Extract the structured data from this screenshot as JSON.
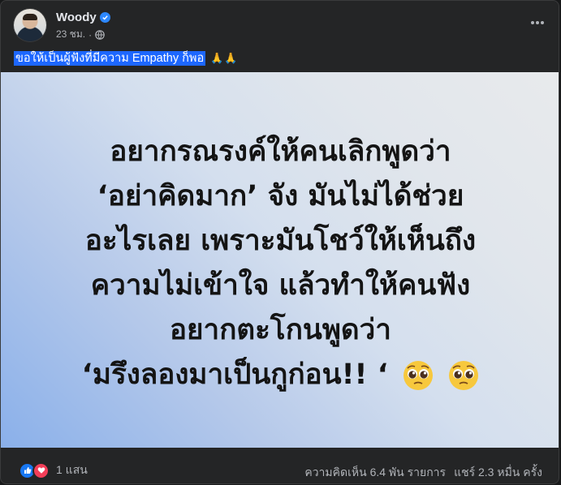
{
  "post": {
    "author": "Woody",
    "time": "23 ชม.",
    "separator": "·",
    "caption": "ขอให้เป็นผู้ฟังที่มีความ Empathy ก็พอ",
    "caption_emoji": "🙏🙏"
  },
  "image_text": {
    "lines": [
      "อยากรณรงค์ให้คนเลิกพูดว่า",
      "‘อย่าคิดมาก’ จัง มันไม่ได้ช่วย",
      "อะไรเลย เพราะมันโชว์ให้เห็นถึง",
      "ความไม่เข้าใจ แล้วทำให้คนฟัง",
      "อยากตะโกนพูดว่า",
      "‘มรึงลองมาเป็นกูก่อน!! ‘"
    ]
  },
  "footer": {
    "reaction_count": "1 แสน",
    "comments": "ความคิดเห็น 6.4 พัน รายการ",
    "shares": "แชร์ 2.3 หมื่น ครั้ง"
  },
  "colors": {
    "card_bg": "#242526",
    "selection": "#1d67ff",
    "verified": "#2d88ff",
    "like": "#1877f2",
    "love": "#f33e58"
  },
  "icons": [
    "verified-badge-icon",
    "globe-icon",
    "more-options-icon",
    "pleading-face-icon",
    "like-reaction-icon",
    "love-reaction-icon"
  ]
}
